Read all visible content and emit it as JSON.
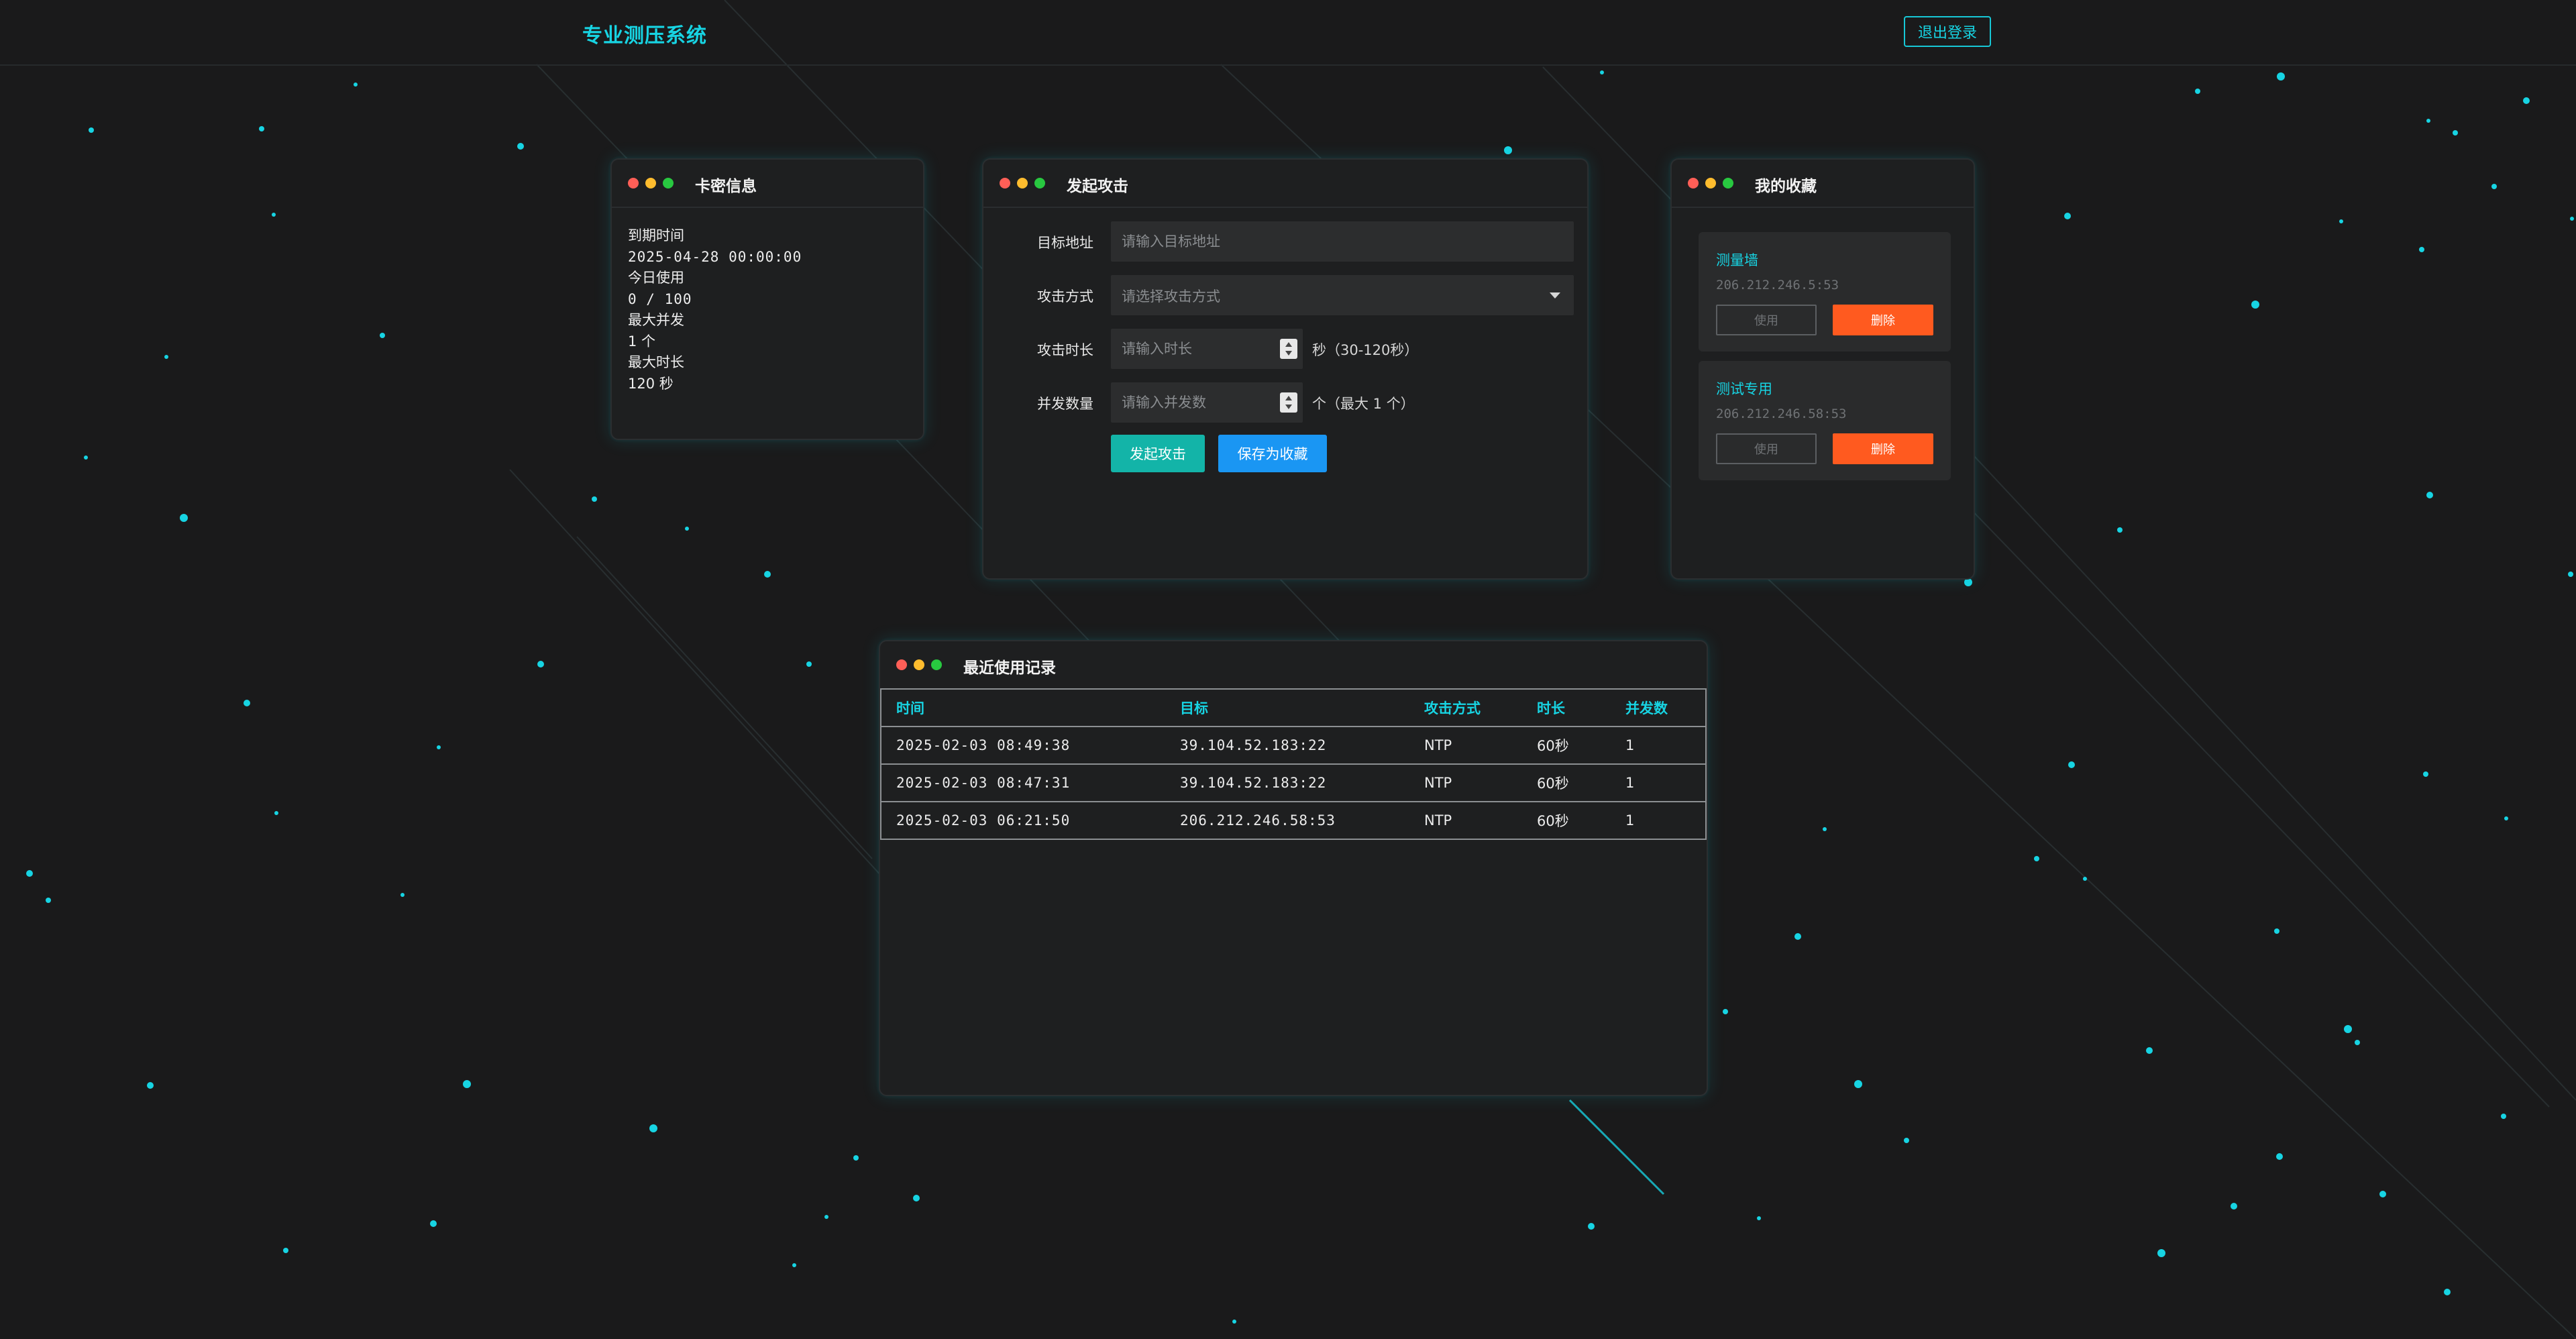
{
  "header": {
    "title": "专业测压系统",
    "logout_label": "退出登录"
  },
  "colors": {
    "accent": "#17d4e3",
    "background": "#1a1a1b",
    "panel": "#1e1f20",
    "attack_button": "#13b4a8",
    "save_button": "#1a96f3",
    "delete_button": "#ff5a1f"
  },
  "card_panel": {
    "title": "卡密信息",
    "expire_label": "到期时间",
    "expire_value": "2025-04-28 00:00:00",
    "today_label": "今日使用",
    "today_value": "0 / 100",
    "max_concurrent_label": "最大并发",
    "max_concurrent_value": "1 个",
    "max_duration_label": "最大时长",
    "max_duration_value": "120 秒"
  },
  "attack_panel": {
    "title": "发起攻击",
    "target_label": "目标地址",
    "target_placeholder": "请输入目标地址",
    "method_label": "攻击方式",
    "method_placeholder": "请选择攻击方式",
    "duration_label": "攻击时长",
    "duration_placeholder": "请输入时长",
    "duration_unit": "秒（30-120秒）",
    "concurrent_label": "并发数量",
    "concurrent_placeholder": "请输入并发数",
    "concurrent_unit": "个（最大 1 个）",
    "start_button": "发起攻击",
    "save_button": "保存为收藏"
  },
  "favorites_panel": {
    "title": "我的收藏",
    "items": [
      {
        "name": "测量墙",
        "target": "206.212.246.5:53",
        "use_label": "使用",
        "delete_label": "删除"
      },
      {
        "name": "测试专用",
        "target": "206.212.246.58:53",
        "use_label": "使用",
        "delete_label": "删除"
      }
    ]
  },
  "records_panel": {
    "title": "最近使用记录",
    "columns": [
      "时间",
      "目标",
      "攻击方式",
      "时长",
      "并发数"
    ],
    "rows": [
      [
        "2025-02-03 08:49:38",
        "39.104.52.183:22",
        "NTP",
        "60秒",
        "1"
      ],
      [
        "2025-02-03 08:47:31",
        "39.104.52.183:22",
        "NTP",
        "60秒",
        "1"
      ],
      [
        "2025-02-03 06:21:50",
        "206.212.246.58:53",
        "NTP",
        "60秒",
        "1"
      ]
    ]
  },
  "icons": {
    "window_dots": [
      "red-dot-icon",
      "yellow-dot-icon",
      "green-dot-icon"
    ],
    "select_caret": "caret-down-icon",
    "spinner": "spinner-icon"
  }
}
